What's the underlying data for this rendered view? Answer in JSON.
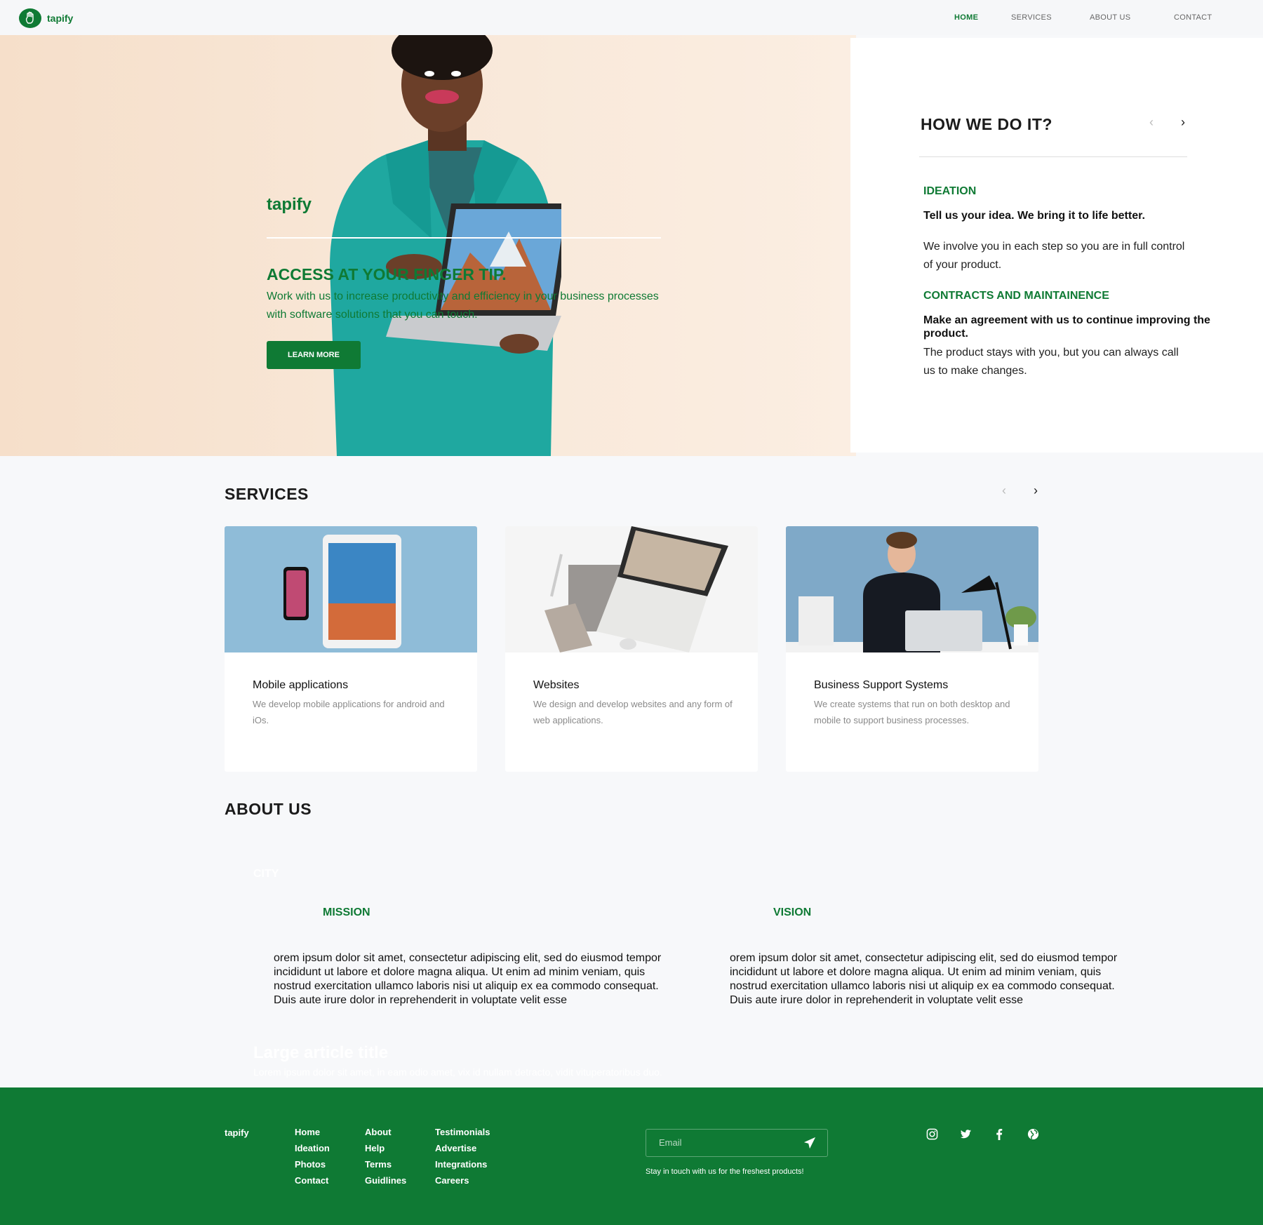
{
  "brand": "tapify",
  "nav": {
    "items": [
      "HOME",
      "SERVICES",
      "ABOUT US",
      "CONTACT"
    ],
    "active": "HOME"
  },
  "hero": {
    "brand": "tapify",
    "title": "ACCESS AT YOUR FINGER TIP.",
    "subtitle": "Work with us to increase productivity and efficiency in your business processes with software solutions that you can touch.",
    "cta": "LEARN MORE"
  },
  "how": {
    "title": "HOW WE DO IT?",
    "sections": [
      {
        "heading": "IDEATION",
        "bold": "Tell us your idea. We bring it to life better.",
        "text": "We involve you in each step so you are in full control of your product."
      },
      {
        "heading": "CONTRACTS AND MAINTAINENCE",
        "bold": "Make an agreement with us to continue improving the product.",
        "text": "The product stays with you, but you can always call us to make changes."
      }
    ]
  },
  "services": {
    "title": "SERVICES",
    "cards": [
      {
        "title": "Mobile applications",
        "text": "We develop mobile applications for android and iOs."
      },
      {
        "title": "Websites",
        "text": "We design and develop websites and any form of web applications."
      },
      {
        "title": "Business Support Systems",
        "text": "We create  systems that run on both desktop and mobile to support business processes."
      }
    ]
  },
  "about": {
    "title": "ABOUT US",
    "city": "CITY",
    "mission": {
      "heading": "MISSION",
      "text": "orem ipsum dolor sit amet, consectetur adipiscing elit, sed do eiusmod tempor incididunt ut labore et dolore magna aliqua. Ut enim ad minim veniam, quis nostrud exercitation ullamco laboris nisi ut aliquip ex ea commodo consequat. Duis aute irure dolor in reprehenderit in voluptate velit esse"
    },
    "vision": {
      "heading": "VISION",
      "text": "orem ipsum dolor sit amet, consectetur adipiscing elit, sed do eiusmod tempor incididunt ut labore et dolore magna aliqua. Ut enim ad minim veniam, quis nostrud exercitation ullamco laboris nisi ut aliquip ex ea commodo consequat. Duis aute irure dolor in reprehenderit in voluptate velit esse"
    },
    "ghost_title": "Large article title",
    "ghost_text": "Lorem ipsum dolor sit amet, in eam odio amet, vix id nullam detracto, vidit vituperatoribus duo."
  },
  "footer": {
    "brand": "tapify",
    "col1": [
      "Home",
      "Ideation",
      "Photos",
      "Contact"
    ],
    "col2": [
      "About",
      "Help",
      "Terms",
      "Guidlines"
    ],
    "col3": [
      "Testimonials",
      "Advertise",
      "Integrations",
      "Careers"
    ],
    "email_placeholder": "Email",
    "note": "Stay in touch with us for the freshest products!",
    "social_icons": [
      "instagram-icon",
      "twitter-icon",
      "facebook-icon",
      "globe-icon"
    ]
  },
  "colors": {
    "accent": "#0f7a34",
    "background": "#f7f8fa"
  }
}
